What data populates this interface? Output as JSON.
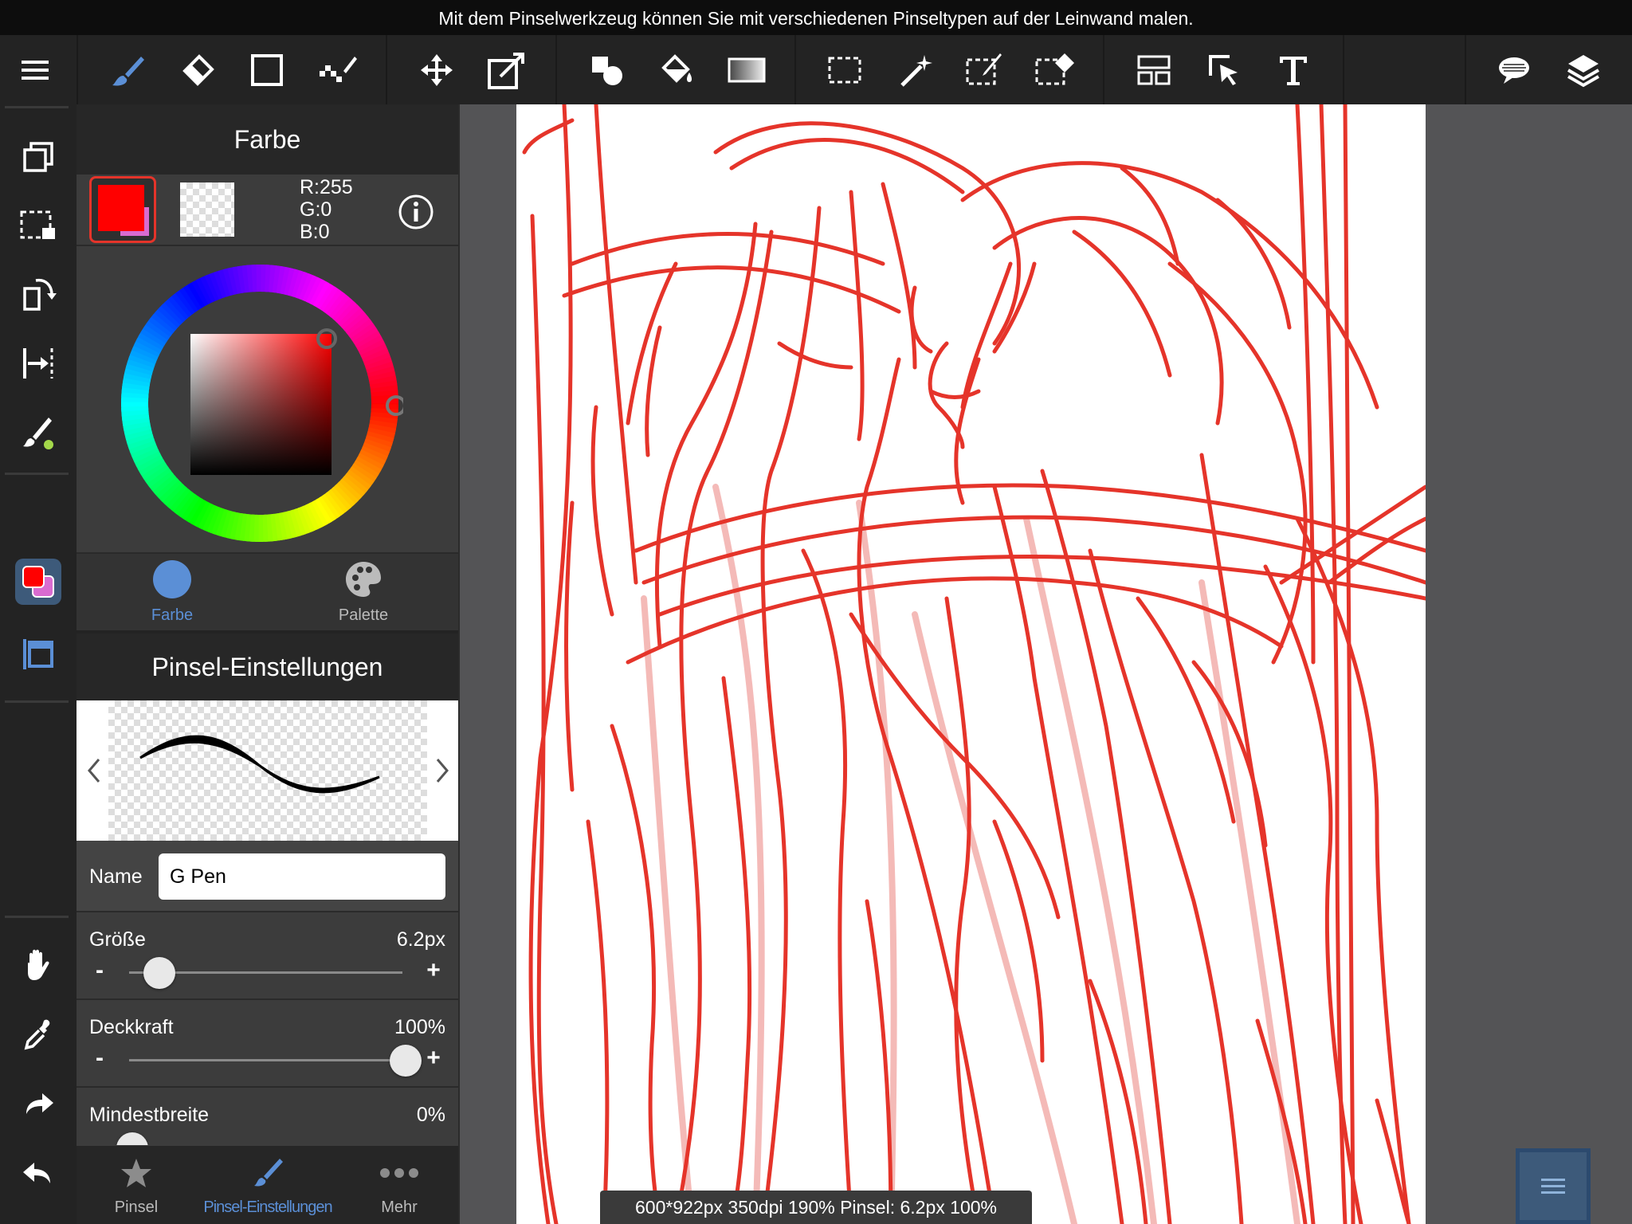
{
  "topbar": {
    "hint": "Mit dem Pinselwerkzeug können Sie mit verschiedenen Pinseltypen auf der Leinwand malen."
  },
  "colors": {
    "accent": "#5b8fd6",
    "current_color": "#ff0000",
    "sketch": "#e5342a",
    "secondary": "#d96bd0"
  },
  "toolbar": {
    "tools": [
      "menu-icon",
      "brush-icon",
      "eraser-icon",
      "rectangle-icon",
      "dot-pen-icon",
      "move-icon",
      "transform-icon",
      "shape-fill-icon",
      "bucket-icon",
      "gradient-icon",
      "select-rect-icon",
      "magic-wand-icon",
      "select-pen-icon",
      "select-eraser-icon",
      "frame-divider-icon",
      "operation-icon",
      "text-icon",
      "speech-bubble-icon",
      "layers-icon"
    ]
  },
  "leftbar": {
    "tools": [
      "layer-copy-icon",
      "select-transform-icon",
      "rotate-icon",
      "snap-icon",
      "brush-settings-icon",
      "color-swatch-icon",
      "canvas-window-icon",
      "hand-icon",
      "eyedropper-icon",
      "redo-icon",
      "undo-icon"
    ]
  },
  "color_panel": {
    "title": "Farbe",
    "r": "R:255",
    "g": "G:0",
    "b": "B:0",
    "tabs": [
      "Farbe",
      "Palette"
    ],
    "active_tab": "Farbe"
  },
  "brush_panel": {
    "title": "Pinsel-Einstellungen",
    "name_label": "Name",
    "name_value": "G Pen",
    "size_label": "Größe",
    "size_value": "6.2px",
    "size_fraction": 0.1,
    "opacity_label": "Deckkraft",
    "opacity_value": "100%",
    "opacity_fraction": 1.0,
    "minwidth_label": "Mindestbreite",
    "minwidth_value": "0%",
    "minwidth_fraction": 0.0,
    "minus": "-",
    "plus": "+"
  },
  "bottom_tabs": {
    "tab1": "Pinsel",
    "tab2": "Pinsel-Einstellungen",
    "tab3": "Mehr",
    "active": "Pinsel-Einstellungen"
  },
  "status": "600*922px 350dpi 190% Pinsel: 6.2px 100%"
}
